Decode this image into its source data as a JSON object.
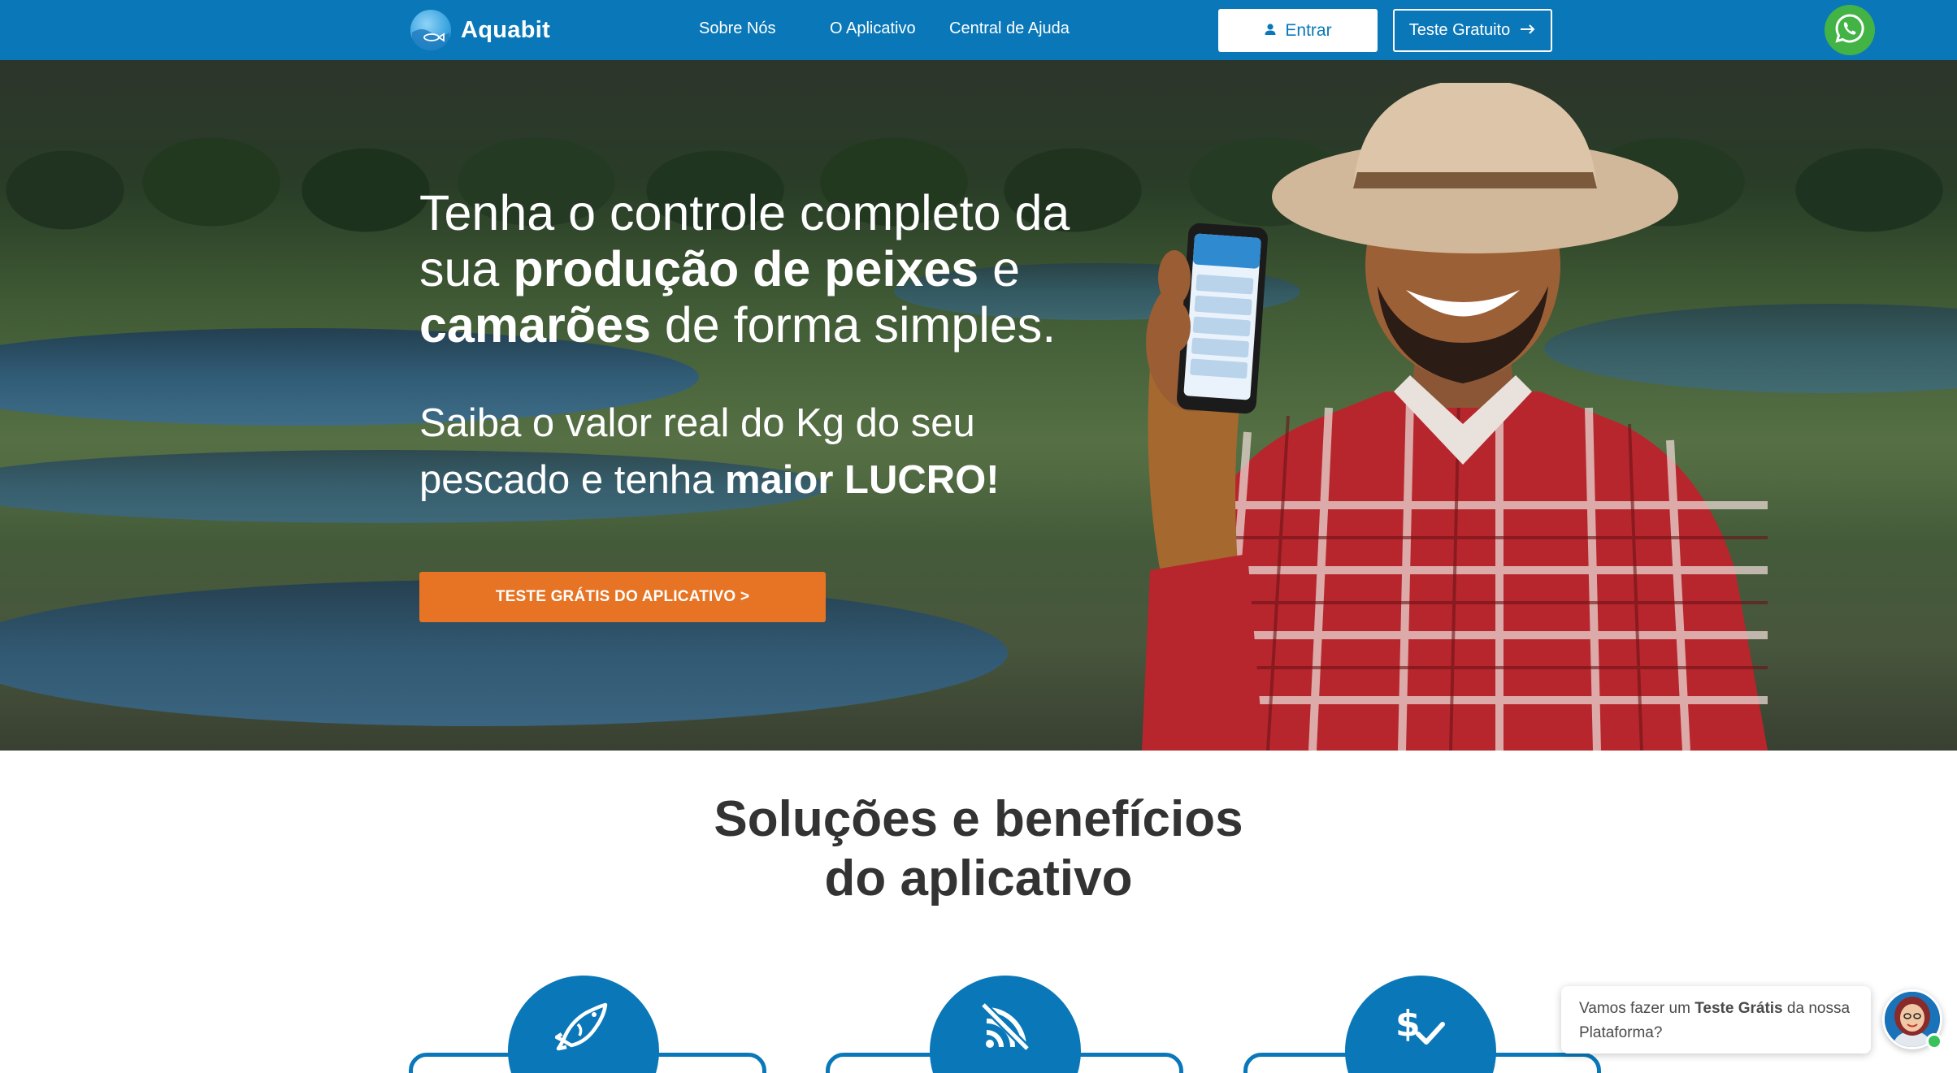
{
  "brand": {
    "name": "Aquabit",
    "color": "#0a78b8",
    "accent": "#e67424"
  },
  "nav": {
    "links": [
      {
        "label": "Sobre Nós"
      },
      {
        "label": "O Aplicativo"
      },
      {
        "label": "Central de Ajuda"
      }
    ],
    "login_label": "Entrar",
    "login_icon": "user-icon",
    "trial_label": "Teste Gratuito",
    "trial_icon": "arrow-right-icon",
    "whatsapp_icon": "whatsapp-icon",
    "whatsapp_color": "#43b346"
  },
  "hero": {
    "title_part1": "Tenha o controle completo da sua ",
    "title_bold1": "produção de peixes",
    "title_part2": " e ",
    "title_bold2": "camarões",
    "title_part3": " de forma simples.",
    "sub_part1": "Saiba o valor real do Kg do seu pescado e tenha ",
    "sub_bold": "maior LUCRO!",
    "cta_label": "TESTE GRÁTIS DO APLICATIVO >"
  },
  "solutions": {
    "title_line1": "Soluções e benefícios",
    "title_line2": "do aplicativo",
    "cards": [
      {
        "icon": "fish-icon"
      },
      {
        "icon": "no-signal-icon"
      },
      {
        "icon": "dollar-check-icon"
      }
    ]
  },
  "chat": {
    "text_part1": "Vamos fazer um ",
    "text_bold": "Teste Grátis",
    "text_part2": " da nossa Plataforma?",
    "online_color": "#39c15a"
  }
}
